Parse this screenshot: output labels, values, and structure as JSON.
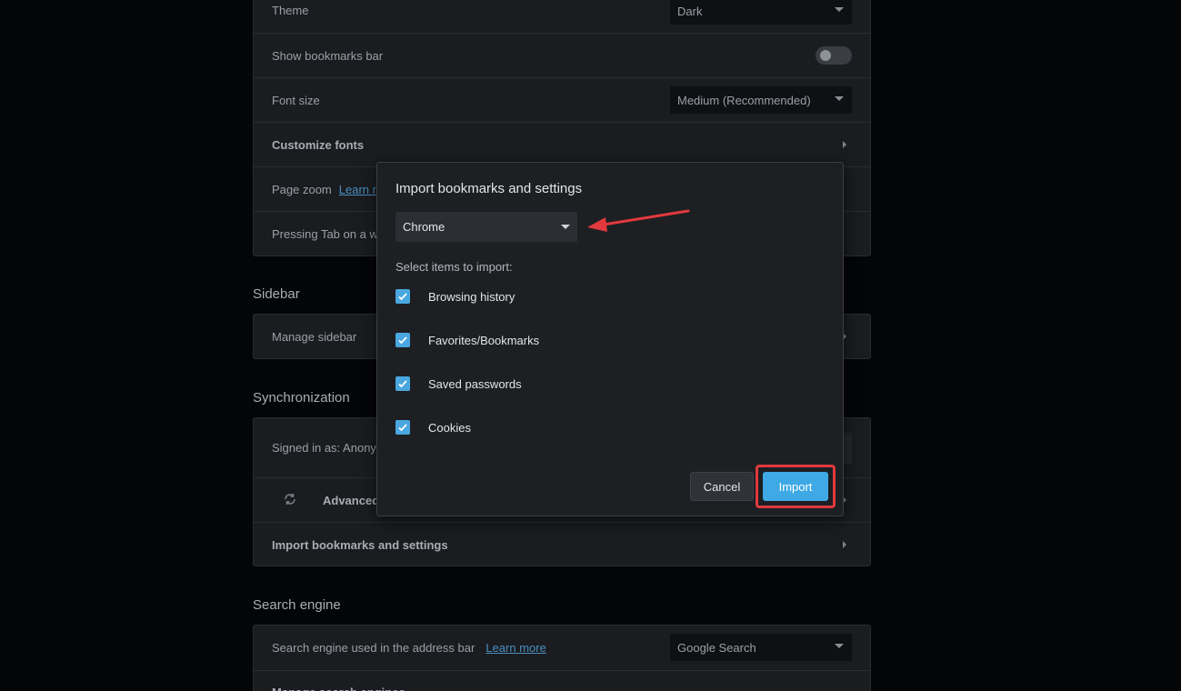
{
  "settings": {
    "theme": {
      "label": "Theme",
      "value": "Dark"
    },
    "bookmarks_bar": {
      "label": "Show bookmarks bar"
    },
    "font_size": {
      "label": "Font size",
      "value": "Medium (Recommended)"
    },
    "customize_fonts": {
      "label": "Customize fonts"
    },
    "page_zoom": {
      "label": "Page zoom",
      "link": "Learn m"
    },
    "pressing_tab": {
      "label": "Pressing Tab on a we"
    }
  },
  "sidebar_section": {
    "title": "Sidebar",
    "manage_label": "Manage sidebar"
  },
  "sync_section": {
    "title": "Synchronization",
    "signed_in_label": "Signed in as: Anonym",
    "advanced_label": "Advanced",
    "import_label": "Import bookmarks and settings"
  },
  "search_section": {
    "title": "Search engine",
    "engine_label": "Search engine used in the address bar",
    "learn_more": "Learn more",
    "engine_value": "Google Search",
    "manage_label": "Manage search engines"
  },
  "dialog": {
    "title": "Import bookmarks and settings",
    "browser": "Chrome",
    "select_label": "Select items to import:",
    "items": [
      {
        "label": "Browsing history",
        "checked": true
      },
      {
        "label": "Favorites/Bookmarks",
        "checked": true
      },
      {
        "label": "Saved passwords",
        "checked": true
      },
      {
        "label": "Cookies",
        "checked": true
      }
    ],
    "cancel_label": "Cancel",
    "import_label": "Import"
  },
  "colors": {
    "accent": "#3fa9e6",
    "highlight": "#e0393e",
    "background": "#040507",
    "panel": "#1a1c20"
  }
}
